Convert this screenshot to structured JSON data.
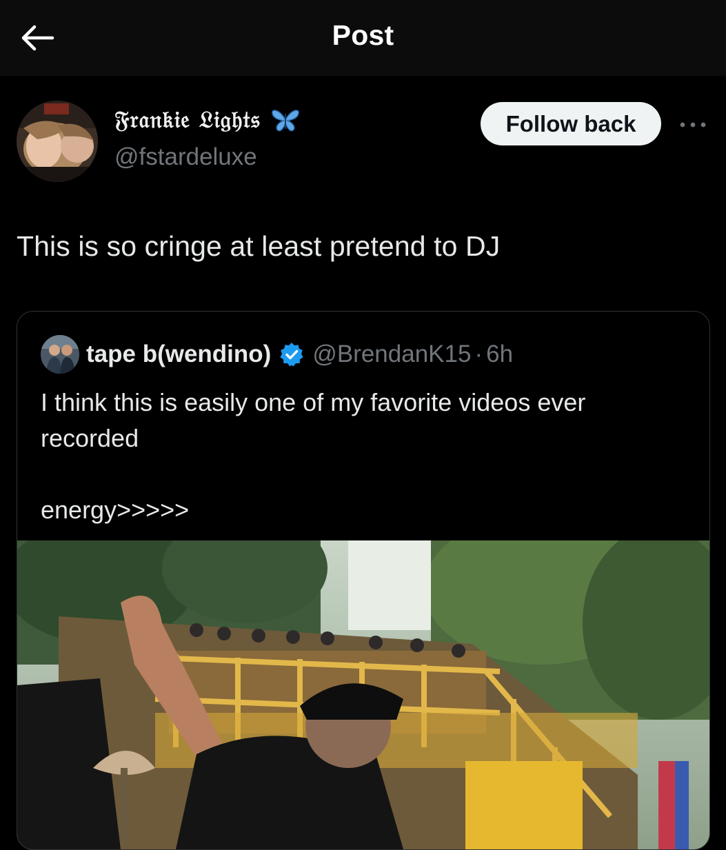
{
  "header": {
    "title": "Post",
    "back_icon": "arrow-left-icon"
  },
  "author": {
    "display_name": "𝔉𝔯𝔞𝔫𝔨𝔦𝔢 𝔏𝔦𝔤𝔥𝔱𝔰",
    "name_emoji": "butterfly-icon",
    "handle": "@fstardeluxe",
    "follow_label": "Follow back",
    "more_icon": "more-horizontal-icon"
  },
  "post": {
    "text": "This is so cringe at least pretend to DJ"
  },
  "quoted": {
    "name": "tape b(wendino)",
    "verified": true,
    "handle": "@BrendanK15",
    "separator": "·",
    "time": "6h",
    "text": "I think this is easily one of my favorite videos ever\nrecorded\n\nenergy>>>>>"
  },
  "colors": {
    "background": "#000000",
    "topbar": "#0c0c0c",
    "text_primary": "#e7e9ea",
    "text_secondary": "#71767b",
    "verified_blue": "#1d9bf0",
    "follow_bg": "#eff3f4",
    "border": "#2f3336"
  }
}
